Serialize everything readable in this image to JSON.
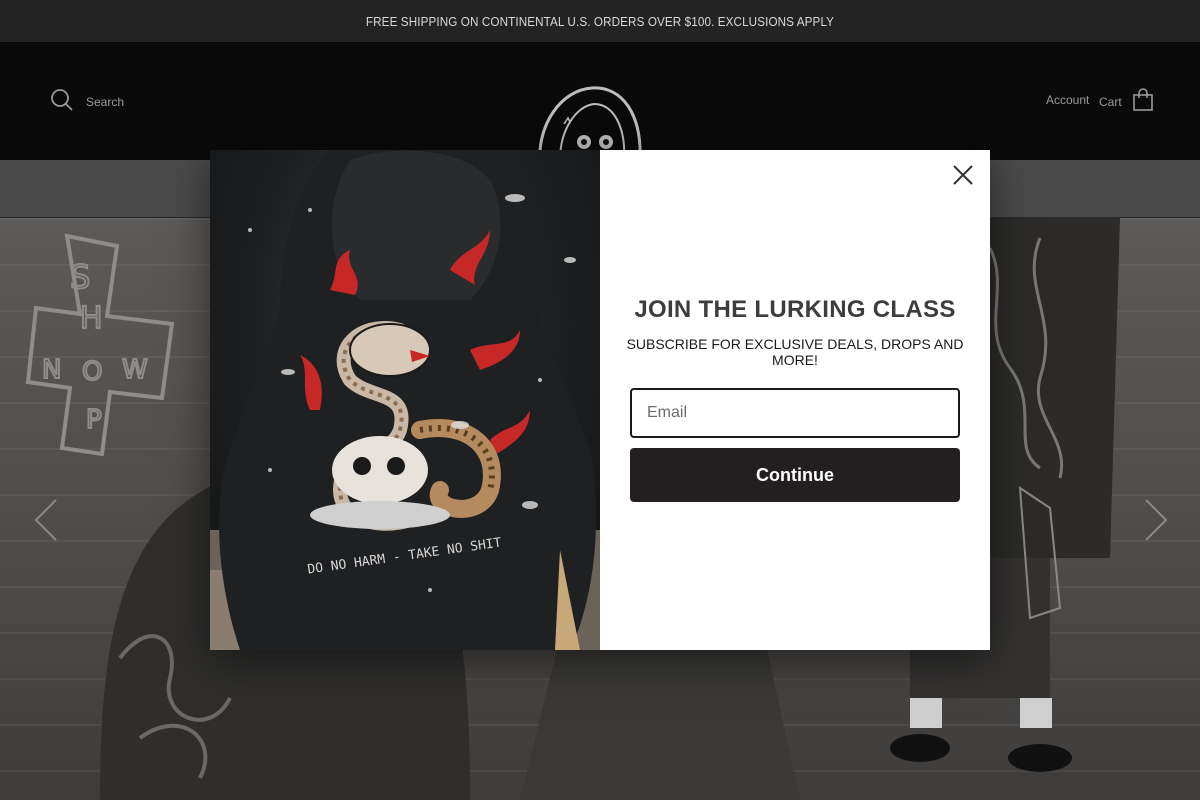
{
  "announcement": {
    "text": "FREE SHIPPING ON CONTINENTAL U.S. ORDERS OVER $100. EXCLUSIONS APPLY"
  },
  "header": {
    "search_label": "Search",
    "account_label": "Account",
    "cart_label": "Cart"
  },
  "hero": {
    "prev_icon": "chevron-left-icon",
    "next_icon": "chevron-right-icon",
    "wall_art_letters": [
      "S",
      "H",
      "N",
      "O",
      "W",
      "P"
    ]
  },
  "modal": {
    "image_caption": "DO NO HARM - TAKE NO SHIT",
    "headline": "JOIN THE LURKING CLASS",
    "subhead": "SUBSCRIBE FOR EXCLUSIVE DEALS, DROPS AND MORE!",
    "email_placeholder": "Email",
    "email_value": "",
    "continue_label": "Continue",
    "close_icon": "close-icon"
  },
  "colors": {
    "announcement_bg": "#232323",
    "header_bg": "#0a0a0a",
    "button_bg": "#231f20",
    "headline": "#3d3d3d"
  }
}
